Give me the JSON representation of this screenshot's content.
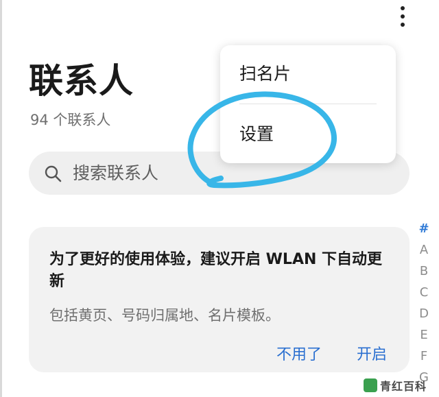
{
  "header": {
    "title": "联系人",
    "count_text": "94 个联系人",
    "more_icon": "more-vertical-icon"
  },
  "search": {
    "placeholder": "搜索联系人",
    "icon": "search-icon"
  },
  "menu": {
    "items": [
      {
        "label": "扫名片"
      },
      {
        "label": "设置"
      }
    ]
  },
  "alpha_index": [
    "#",
    "A",
    "B",
    "C",
    "D",
    "E",
    "F",
    "G"
  ],
  "wlan_card": {
    "title": "为了更好的使用体验，建议开启 WLAN 下自动更新",
    "description": "包括黄页、号码归属地、名片模板。",
    "decline_label": "不用了",
    "enable_label": "开启"
  },
  "watermark": {
    "text": "青红百科"
  },
  "colors": {
    "accent": "#2a6fd0",
    "annotation": "#38b6e8",
    "card_bg": "#f2f2f2"
  }
}
